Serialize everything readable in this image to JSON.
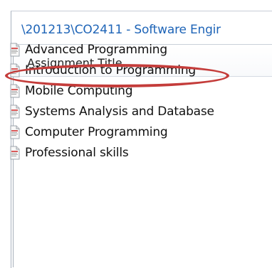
{
  "window": {
    "path": "\\201213\\CO2411 - Software Engir"
  },
  "list": {
    "column_header": "Assignment Title",
    "items": [
      {
        "label": "Advanced Programming",
        "icon": "document-icon"
      },
      {
        "label": "Introduction to Programming",
        "icon": "document-icon"
      },
      {
        "label": "Mobile Computing",
        "icon": "document-icon"
      },
      {
        "label": "Systems Analysis and Database",
        "icon": "document-icon"
      },
      {
        "label": "Computer Programming",
        "icon": "document-icon"
      },
      {
        "label": "Professional skills",
        "icon": "document-icon"
      }
    ]
  },
  "annotation": {
    "highlight_color": "#c43c3a"
  }
}
